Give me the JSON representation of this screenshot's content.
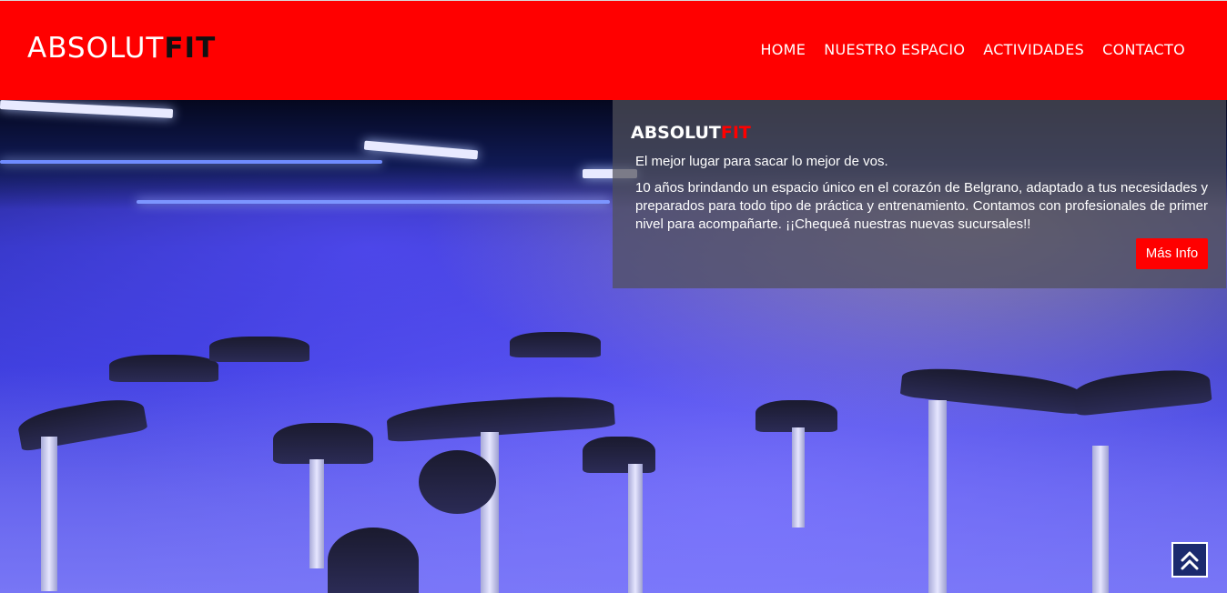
{
  "header": {
    "logo_part1": "ABSOLUT",
    "logo_part2": "FIT",
    "nav": [
      {
        "label": "HOME"
      },
      {
        "label": "NUESTRO ESPACIO"
      },
      {
        "label": "ACTIVIDADES"
      },
      {
        "label": "CONTACTO"
      }
    ]
  },
  "hero": {
    "info_logo_part1": "ABSOLUT",
    "info_logo_part2": "FIT",
    "tagline": "El mejor lugar para sacar lo mejor de vos.",
    "description": "10 años brindando un espacio único en el corazón de Belgrano, adaptado a tus necesidades y preparados para todo tipo de práctica y entrenamiento. Contamos con profesionales de primer nivel para acompañarte. ¡¡Chequeá nuestras nuevas sucursales!!",
    "button_label": "Más Info"
  },
  "colors": {
    "brand_red": "#ff0000",
    "logo_dark": "#111111"
  },
  "icons": {
    "scroll_top": "double-chevron-up-icon"
  }
}
